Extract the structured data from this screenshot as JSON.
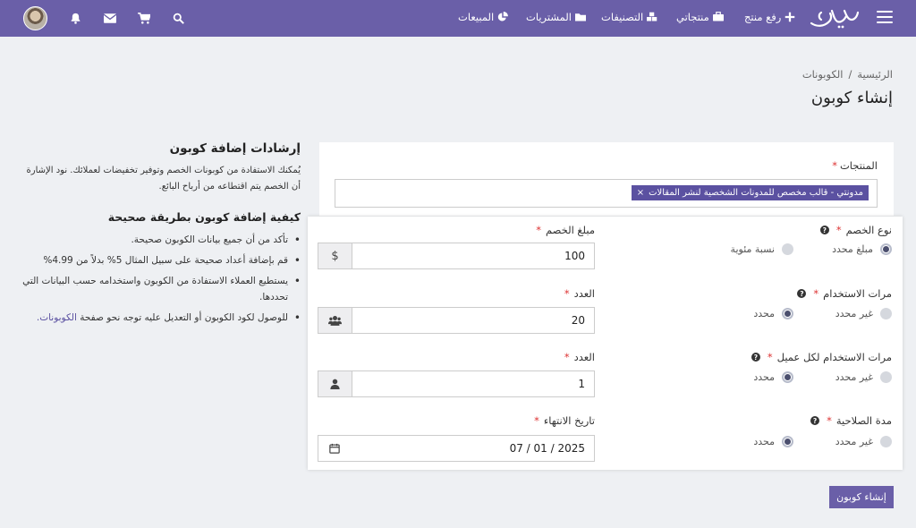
{
  "navbar": {
    "links": {
      "upload_product": "رفع منتج",
      "my_products": "منتجاتي",
      "categories": "التصنيفات",
      "purchases": "المشتريات",
      "sales": "المبيعات"
    }
  },
  "breadcrumb": {
    "home": "الرئيسية",
    "separator": "/",
    "coupons": "الكوبونات"
  },
  "page_title": "إنشاء كوبون",
  "guidelines": {
    "title": "إرشادات إضافة كوبون",
    "intro": "يُمكنك الاستفادة من كوبونات الخصم وتوفير تخفيضات لعملائك. نود الإشارة أن الخصم يتم اقتطاعه من أرباح البائع.",
    "howto_title": "كيفية إضافة كوبون بطريقة صحيحة",
    "bullets": [
      "تأكد من أن جميع بيانات الكوبون صحيحة.",
      "قم بإضافة أعداد صحيحة على سبيل المثال 5% بدلاً من 4.99%",
      "يستطيع العملاء الاستفادة من الكوبون واستخدامه حسب البيانات التي تحددها."
    ],
    "last_bullet_text": "للوصول لكود الكوبون أو التعديل عليه توجه نحو صفحة",
    "last_bullet_link": "الكوبونات."
  },
  "form": {
    "products_label": "المنتجات",
    "required_mark": "*",
    "selected_product": "مدونتي - قالب مخصص للمدونات الشخصية لنشر المقالات",
    "chip_remove": "×",
    "discount_type": {
      "label": "نوع الخصم",
      "options": [
        "مبلغ محدد",
        "نسبة مئوية"
      ],
      "selected": "مبلغ محدد"
    },
    "discount_amount": {
      "label": "مبلغ الخصم",
      "value": "100",
      "addon": "$"
    },
    "usage_count": {
      "label": "مرات الاستخدام",
      "options": [
        "غير محدد",
        "محدد"
      ],
      "selected": "محدد"
    },
    "count": {
      "label": "العدد",
      "value": "20"
    },
    "usage_per_customer": {
      "label": "مرات الاستخدام لكل عميل",
      "options": [
        "غير محدد",
        "محدد"
      ],
      "selected": "محدد"
    },
    "count_per_customer": {
      "label": "العدد",
      "value": "1"
    },
    "validity": {
      "label": "مدة الصلاحية",
      "options": [
        "غير محدد",
        "محدد"
      ],
      "selected": "محدد"
    },
    "expiry_date": {
      "label": "تاريخ الانتهاء",
      "value": "07 / 01 / 2025"
    },
    "help_icon": "?",
    "submit_label": "إنشاء كوبون"
  },
  "colors": {
    "navbar": "#6a5fa8",
    "accent": "#5b51a1",
    "background": "#eef0f3"
  },
  "icons": [
    "hamburger-icon",
    "plus-icon",
    "briefcase-icon",
    "cubes-icon",
    "folder-icon",
    "pie-chart-icon",
    "search-icon",
    "cart-icon",
    "envelope-icon",
    "bell-icon",
    "users-icon",
    "user-icon",
    "calendar-icon"
  ]
}
